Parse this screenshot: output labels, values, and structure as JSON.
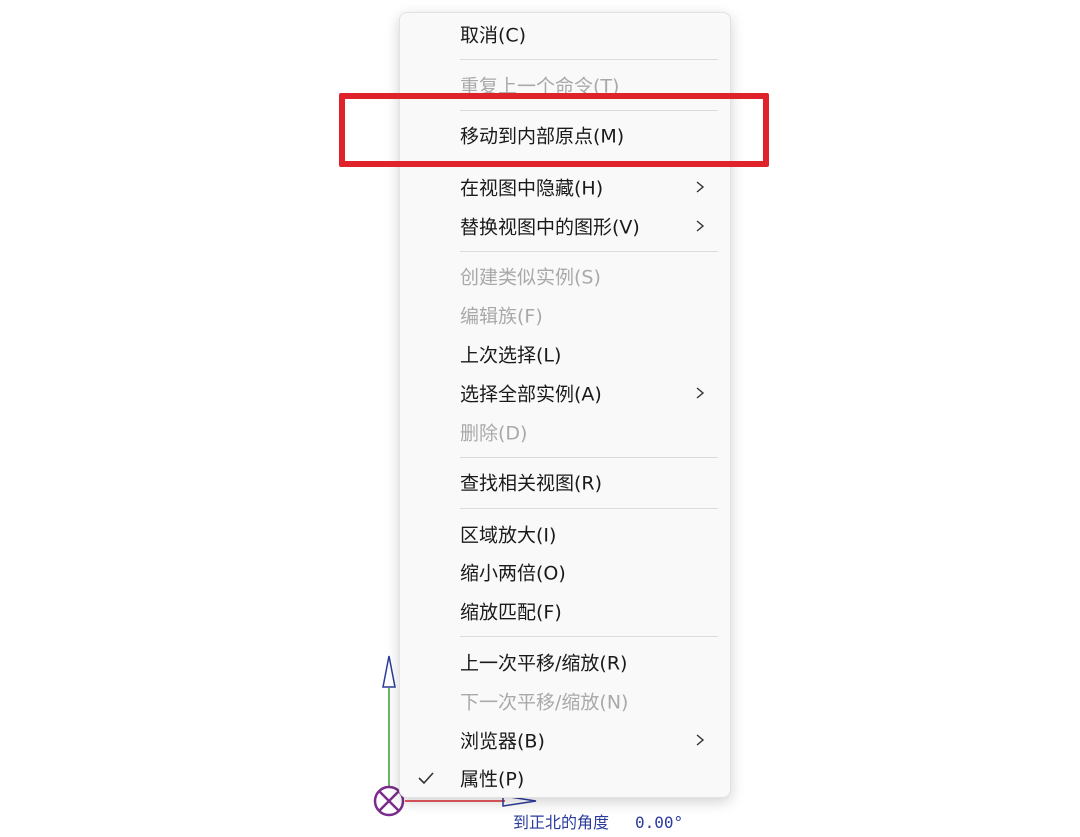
{
  "menu": {
    "items": [
      {
        "label": "取消(C)",
        "enabled": true,
        "submenu": false,
        "checked": false
      },
      {
        "label": "重复上一个命令(T)",
        "enabled": false,
        "submenu": false,
        "checked": false
      },
      {
        "label": "移动到内部原点(M)",
        "enabled": true,
        "submenu": false,
        "checked": false
      },
      {
        "label": "在视图中隐藏(H)",
        "enabled": true,
        "submenu": true,
        "checked": false
      },
      {
        "label": "替换视图中的图形(V)",
        "enabled": true,
        "submenu": true,
        "checked": false
      },
      {
        "label": "创建类似实例(S)",
        "enabled": false,
        "submenu": false,
        "checked": false
      },
      {
        "label": "编辑族(F)",
        "enabled": false,
        "submenu": false,
        "checked": false
      },
      {
        "label": "上次选择(L)",
        "enabled": true,
        "submenu": false,
        "checked": false
      },
      {
        "label": "选择全部实例(A)",
        "enabled": true,
        "submenu": true,
        "checked": false
      },
      {
        "label": "删除(D)",
        "enabled": false,
        "submenu": false,
        "checked": false
      },
      {
        "label": "查找相关视图(R)",
        "enabled": true,
        "submenu": false,
        "checked": false
      },
      {
        "label": "区域放大(I)",
        "enabled": true,
        "submenu": false,
        "checked": false
      },
      {
        "label": "缩小两倍(O)",
        "enabled": true,
        "submenu": false,
        "checked": false
      },
      {
        "label": "缩放匹配(F)",
        "enabled": true,
        "submenu": false,
        "checked": false
      },
      {
        "label": "上一次平移/缩放(R)",
        "enabled": true,
        "submenu": false,
        "checked": false
      },
      {
        "label": "下一次平移/缩放(N)",
        "enabled": false,
        "submenu": false,
        "checked": false
      },
      {
        "label": "浏览器(B)",
        "enabled": true,
        "submenu": true,
        "checked": false
      },
      {
        "label": "属性(P)",
        "enabled": true,
        "submenu": false,
        "checked": true
      }
    ],
    "highlighted_item": "移动到内部原点(M)"
  },
  "north_indicator": {
    "label": "到正北的角度",
    "value": "0.00°"
  },
  "colors": {
    "highlight": "#e0232b",
    "enabled_text": "#1a1a1a",
    "disabled_text": "#a9a9a9",
    "axis_y": "#2b3b9c",
    "axis_x": "#e0232b",
    "origin": "#7a2c8c"
  },
  "icons": {
    "submenu": "chevron-right-icon",
    "checked": "checkmark-icon",
    "origin": "origin-marker-icon"
  }
}
